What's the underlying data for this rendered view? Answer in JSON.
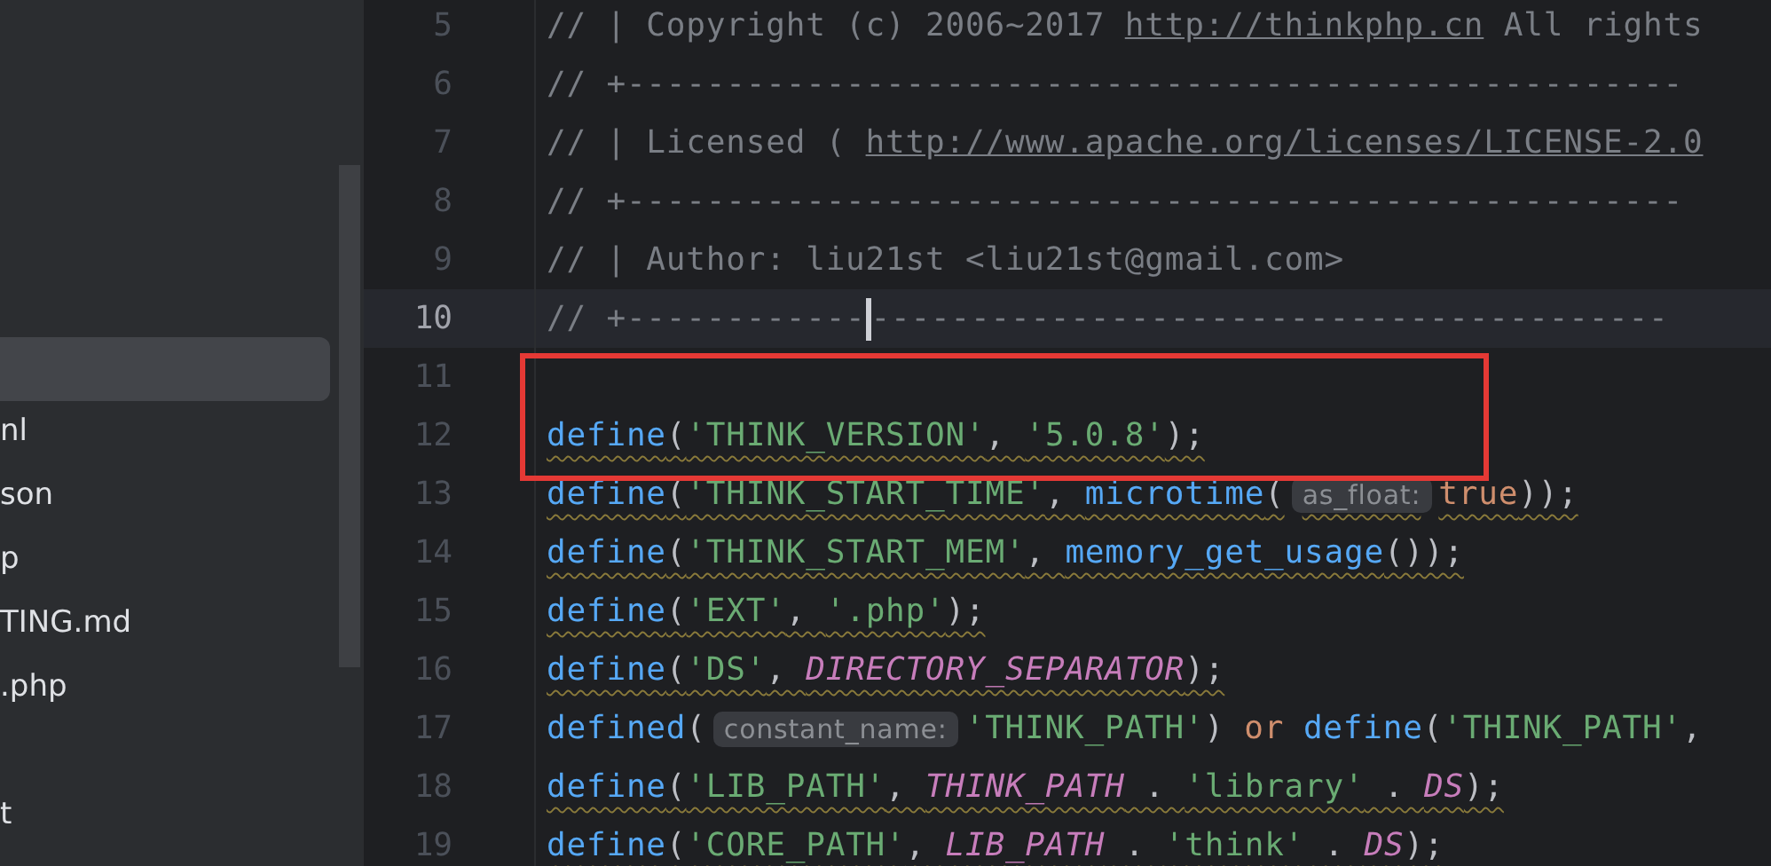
{
  "sidebar": {
    "items": [
      {
        "selected": true
      },
      {
        "label": "nl",
        "selected": false
      },
      {
        "label": "son",
        "selected": false
      },
      {
        "label": "p",
        "selected": false
      },
      {
        "label": "TING.md",
        "selected": false
      },
      {
        "label": ".php",
        "selected": false
      },
      {
        "selected": false
      },
      {
        "label": "t",
        "selected": false
      }
    ]
  },
  "editor": {
    "lines": [
      {
        "number": "5",
        "current": false,
        "warning": false,
        "tokens": [
          {
            "kind": "comment",
            "text": "// | Copyright (c) 2006~2017 "
          },
          {
            "kind": "link",
            "text": "http://thinkphp.cn"
          },
          {
            "kind": "comment",
            "text": " All rights"
          }
        ]
      },
      {
        "number": "6",
        "current": false,
        "warning": false,
        "tokens": [
          {
            "kind": "comment",
            "text": "// +-----------------------------------------------------"
          }
        ]
      },
      {
        "number": "7",
        "current": false,
        "warning": false,
        "tokens": [
          {
            "kind": "comment",
            "text": "// | Licensed ( "
          },
          {
            "kind": "link",
            "text": "http://www.apache.org/licenses/LICENSE-2.0"
          }
        ]
      },
      {
        "number": "8",
        "current": false,
        "warning": false,
        "tokens": [
          {
            "kind": "comment",
            "text": "// +-----------------------------------------------------"
          }
        ]
      },
      {
        "number": "9",
        "current": false,
        "warning": false,
        "tokens": [
          {
            "kind": "comment",
            "text": "// | Author: liu21st <liu21st@gmail.com>"
          }
        ]
      },
      {
        "number": "10",
        "current": true,
        "warning": false,
        "tokens": [
          {
            "kind": "comment",
            "text": "// +------------"
          },
          {
            "kind": "caret"
          },
          {
            "kind": "comment",
            "text": "----------------------------------------"
          }
        ]
      },
      {
        "number": "11",
        "current": false,
        "warning": false
      },
      {
        "number": "12",
        "current": false,
        "warning": true,
        "tokens": [
          {
            "kind": "fn",
            "text": "define"
          },
          {
            "kind": "punc",
            "text": "("
          },
          {
            "kind": "str",
            "text": "'THINK_VERSION'"
          },
          {
            "kind": "punc",
            "text": ", "
          },
          {
            "kind": "str",
            "text": "'5.0.8'"
          },
          {
            "kind": "punc",
            "text": ");"
          }
        ]
      },
      {
        "number": "13",
        "current": false,
        "warning": true,
        "tokens": [
          {
            "kind": "fn",
            "text": "define"
          },
          {
            "kind": "punc",
            "text": "("
          },
          {
            "kind": "str",
            "text": "'THINK_START_TIME'"
          },
          {
            "kind": "punc",
            "text": ", "
          },
          {
            "kind": "fn",
            "text": "microtime"
          },
          {
            "kind": "punc",
            "text": "("
          },
          {
            "kind": "hint",
            "text": "as_float:"
          },
          {
            "kind": "kw",
            "text": "true"
          },
          {
            "kind": "punc",
            "text": "));"
          }
        ]
      },
      {
        "number": "14",
        "current": false,
        "warning": true,
        "tokens": [
          {
            "kind": "fn",
            "text": "define"
          },
          {
            "kind": "punc",
            "text": "("
          },
          {
            "kind": "str",
            "text": "'THINK_START_MEM'"
          },
          {
            "kind": "punc",
            "text": ", "
          },
          {
            "kind": "fn",
            "text": "memory_get_usage"
          },
          {
            "kind": "punc",
            "text": "());"
          }
        ]
      },
      {
        "number": "15",
        "current": false,
        "warning": true,
        "tokens": [
          {
            "kind": "fn",
            "text": "define"
          },
          {
            "kind": "punc",
            "text": "("
          },
          {
            "kind": "str",
            "text": "'EXT'"
          },
          {
            "kind": "punc",
            "text": ", "
          },
          {
            "kind": "str",
            "text": "'.php'"
          },
          {
            "kind": "punc",
            "text": ");"
          }
        ]
      },
      {
        "number": "16",
        "current": false,
        "warning": true,
        "tokens": [
          {
            "kind": "fn",
            "text": "define"
          },
          {
            "kind": "punc",
            "text": "("
          },
          {
            "kind": "str",
            "text": "'DS'"
          },
          {
            "kind": "punc",
            "text": ", "
          },
          {
            "kind": "const",
            "text": "DIRECTORY_SEPARATOR"
          },
          {
            "kind": "punc",
            "text": ");"
          }
        ]
      },
      {
        "number": "17",
        "current": false,
        "warning": false,
        "tokens": [
          {
            "kind": "fn",
            "text": "defined"
          },
          {
            "kind": "punc",
            "text": "("
          },
          {
            "kind": "hint",
            "text": "constant_name:"
          },
          {
            "kind": "str",
            "text": "'THINK_PATH'"
          },
          {
            "kind": "punc",
            "text": ") "
          },
          {
            "kind": "kw",
            "text": "or"
          },
          {
            "kind": "fn",
            "text": "define"
          },
          {
            "kind": "punc",
            "text": "("
          },
          {
            "kind": "str",
            "text": "'THINK_PATH'"
          },
          {
            "kind": "punc",
            "text": ","
          }
        ]
      },
      {
        "number": "18",
        "current": false,
        "warning": true,
        "tokens": [
          {
            "kind": "fn",
            "text": "define"
          },
          {
            "kind": "punc",
            "text": "("
          },
          {
            "kind": "str",
            "text": "'LIB_PATH'"
          },
          {
            "kind": "punc",
            "text": ", "
          },
          {
            "kind": "const",
            "text": "THINK_PATH"
          },
          {
            "kind": "punc",
            "text": " . "
          },
          {
            "kind": "str",
            "text": "'library'"
          },
          {
            "kind": "punc",
            "text": " . "
          },
          {
            "kind": "const",
            "text": "DS"
          },
          {
            "kind": "punc",
            "text": ");"
          }
        ]
      },
      {
        "number": "19",
        "current": false,
        "warning": true,
        "tokens": [
          {
            "kind": "fn",
            "text": "define"
          },
          {
            "kind": "punc",
            "text": "("
          },
          {
            "kind": "str",
            "text": "'CORE_PATH'"
          },
          {
            "kind": "punc",
            "text": ", "
          },
          {
            "kind": "const",
            "text": "LIB_PATH"
          },
          {
            "kind": "punc",
            "text": " . "
          },
          {
            "kind": "str",
            "text": "'think'"
          },
          {
            "kind": "punc",
            "text": " . "
          },
          {
            "kind": "const",
            "text": "DS"
          },
          {
            "kind": "punc",
            "text": ");"
          }
        ]
      }
    ]
  }
}
